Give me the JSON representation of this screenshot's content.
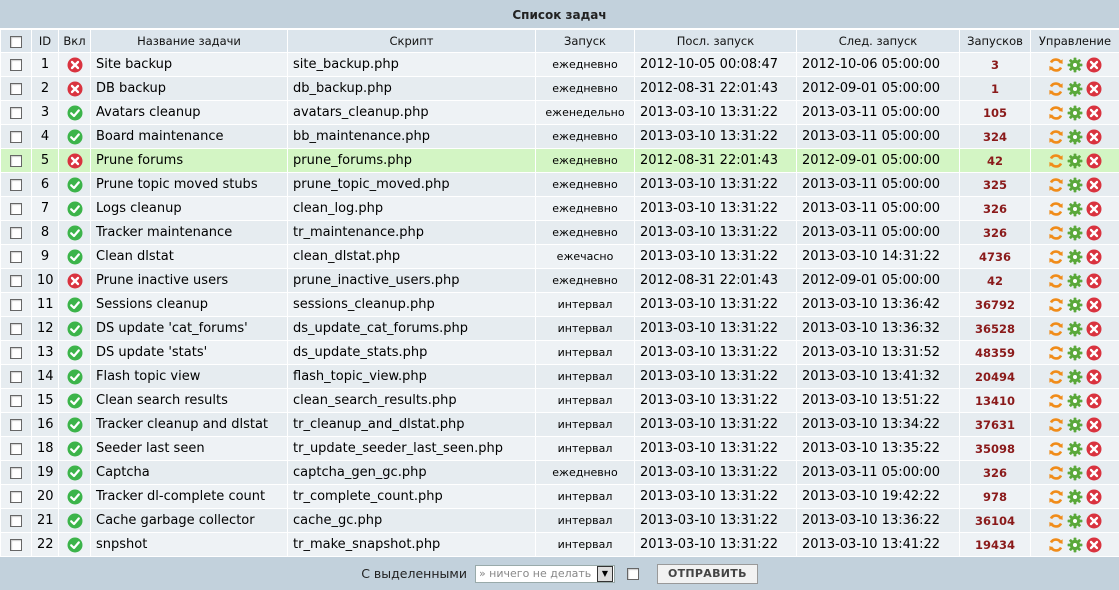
{
  "caption": "Список задач",
  "headers": {
    "id": "ID",
    "enabled": "Вкл",
    "name": "Название задачи",
    "script": "Скрипт",
    "run": "Запуск",
    "last_run": "Посл. запуск",
    "next_run": "След. запуск",
    "runs": "Запусков",
    "control": "Управление"
  },
  "rows": [
    {
      "id": "1",
      "enabled": false,
      "name": "Site backup",
      "script": "site_backup.php",
      "freq": "ежедневно",
      "last": "2012-10-05 00:08:47",
      "next": "2012-10-06 05:00:00",
      "runs": "3"
    },
    {
      "id": "2",
      "enabled": false,
      "name": "DB backup",
      "script": "db_backup.php",
      "freq": "ежедневно",
      "last": "2012-08-31 22:01:43",
      "next": "2012-09-01 05:00:00",
      "runs": "1"
    },
    {
      "id": "3",
      "enabled": true,
      "name": "Avatars cleanup",
      "script": "avatars_cleanup.php",
      "freq": "еженедельно",
      "last": "2013-03-10 13:31:22",
      "next": "2013-03-11 05:00:00",
      "runs": "105"
    },
    {
      "id": "4",
      "enabled": true,
      "name": "Board maintenance",
      "script": "bb_maintenance.php",
      "freq": "ежедневно",
      "last": "2013-03-10 13:31:22",
      "next": "2013-03-11 05:00:00",
      "runs": "324"
    },
    {
      "id": "5",
      "enabled": false,
      "name": "Prune forums",
      "script": "prune_forums.php",
      "freq": "ежедневно",
      "last": "2012-08-31 22:01:43",
      "next": "2012-09-01 05:00:00",
      "runs": "42",
      "highlight": true
    },
    {
      "id": "6",
      "enabled": true,
      "name": "Prune topic moved stubs",
      "script": "prune_topic_moved.php",
      "freq": "ежедневно",
      "last": "2013-03-10 13:31:22",
      "next": "2013-03-11 05:00:00",
      "runs": "325"
    },
    {
      "id": "7",
      "enabled": true,
      "name": "Logs cleanup",
      "script": "clean_log.php",
      "freq": "ежедневно",
      "last": "2013-03-10 13:31:22",
      "next": "2013-03-11 05:00:00",
      "runs": "326"
    },
    {
      "id": "8",
      "enabled": true,
      "name": "Tracker maintenance",
      "script": "tr_maintenance.php",
      "freq": "ежедневно",
      "last": "2013-03-10 13:31:22",
      "next": "2013-03-11 05:00:00",
      "runs": "326"
    },
    {
      "id": "9",
      "enabled": true,
      "name": "Clean dlstat",
      "script": "clean_dlstat.php",
      "freq": "ежечасно",
      "last": "2013-03-10 13:31:22",
      "next": "2013-03-10 14:31:22",
      "runs": "4736"
    },
    {
      "id": "10",
      "enabled": false,
      "name": "Prune inactive users",
      "script": "prune_inactive_users.php",
      "freq": "ежедневно",
      "last": "2012-08-31 22:01:43",
      "next": "2012-09-01 05:00:00",
      "runs": "42"
    },
    {
      "id": "11",
      "enabled": true,
      "name": "Sessions cleanup",
      "script": "sessions_cleanup.php",
      "freq": "интервал",
      "last": "2013-03-10 13:31:22",
      "next": "2013-03-10 13:36:42",
      "runs": "36792"
    },
    {
      "id": "12",
      "enabled": true,
      "name": "DS update 'cat_forums'",
      "script": "ds_update_cat_forums.php",
      "freq": "интервал",
      "last": "2013-03-10 13:31:22",
      "next": "2013-03-10 13:36:32",
      "runs": "36528"
    },
    {
      "id": "13",
      "enabled": true,
      "name": "DS update 'stats'",
      "script": "ds_update_stats.php",
      "freq": "интервал",
      "last": "2013-03-10 13:31:22",
      "next": "2013-03-10 13:31:52",
      "runs": "48359"
    },
    {
      "id": "14",
      "enabled": true,
      "name": "Flash topic view",
      "script": "flash_topic_view.php",
      "freq": "интервал",
      "last": "2013-03-10 13:31:22",
      "next": "2013-03-10 13:41:32",
      "runs": "20494"
    },
    {
      "id": "15",
      "enabled": true,
      "name": "Clean search results",
      "script": "clean_search_results.php",
      "freq": "интервал",
      "last": "2013-03-10 13:31:22",
      "next": "2013-03-10 13:51:22",
      "runs": "13410"
    },
    {
      "id": "16",
      "enabled": true,
      "name": "Tracker cleanup and dlstat",
      "script": "tr_cleanup_and_dlstat.php",
      "freq": "интервал",
      "last": "2013-03-10 13:31:22",
      "next": "2013-03-10 13:34:22",
      "runs": "37631"
    },
    {
      "id": "18",
      "enabled": true,
      "name": "Seeder last seen",
      "script": "tr_update_seeder_last_seen.php",
      "freq": "интервал",
      "last": "2013-03-10 13:31:22",
      "next": "2013-03-10 13:35:22",
      "runs": "35098"
    },
    {
      "id": "19",
      "enabled": true,
      "name": "Captcha",
      "script": "captcha_gen_gc.php",
      "freq": "ежедневно",
      "last": "2013-03-10 13:31:22",
      "next": "2013-03-11 05:00:00",
      "runs": "326"
    },
    {
      "id": "20",
      "enabled": true,
      "name": "Tracker dl-complete count",
      "script": "tr_complete_count.php",
      "freq": "интервал",
      "last": "2013-03-10 13:31:22",
      "next": "2013-03-10 19:42:22",
      "runs": "978"
    },
    {
      "id": "21",
      "enabled": true,
      "name": "Cache garbage collector",
      "script": "cache_gc.php",
      "freq": "интервал",
      "last": "2013-03-10 13:31:22",
      "next": "2013-03-10 13:36:22",
      "runs": "36104"
    },
    {
      "id": "22",
      "enabled": true,
      "name": "snpshot",
      "script": "tr_make_snapshot.php",
      "freq": "интервал",
      "last": "2013-03-10 13:31:22",
      "next": "2013-03-10 13:41:22",
      "runs": "19434"
    }
  ],
  "footer": {
    "label": "С выделенными",
    "select_value": "» ничего не делать",
    "submit": "ОТПРАВИТЬ"
  },
  "colors": {
    "enabled": "#3cb44a",
    "disabled": "#d9333f",
    "refresh": "#f08c1a",
    "gear": "#5aa83a",
    "runs_text": "#8a1a1a",
    "highlight_row": "#d3f5c4"
  },
  "icons": {
    "enabled": "check-circle-icon",
    "disabled": "x-circle-icon",
    "run": "refresh-icon",
    "edit": "gear-icon",
    "delete": "delete-icon"
  }
}
